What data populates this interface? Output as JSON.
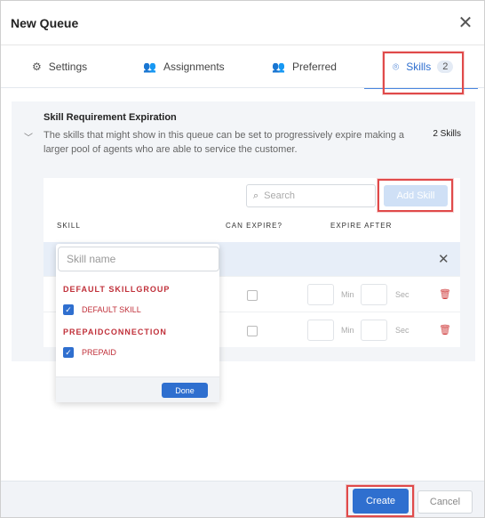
{
  "dialog": {
    "title": "New Queue",
    "close_icon": "close-icon"
  },
  "tabs": [
    {
      "label": "Settings",
      "icon": "gear-icon"
    },
    {
      "label": "Assignments",
      "icon": "users-icon"
    },
    {
      "label": "Preferred",
      "icon": "users-icon"
    },
    {
      "label": "Skills",
      "icon": "location-pin-icon",
      "badge": "2",
      "active": true
    }
  ],
  "section": {
    "title": "Skill Requirement Expiration",
    "description": "The skills that might show in this queue can be set to progressively expire making a larger pool of agents who are able to service the customer.",
    "count": "2 Skills"
  },
  "toolbar": {
    "search_placeholder": "Search",
    "add_skill": "Add Skill"
  },
  "columns": {
    "skill": "SKILL",
    "can_expire": "CAN EXPIRE?",
    "expire_after": "EXPIRE AFTER"
  },
  "row_units": {
    "min": "Min",
    "sec": "Sec"
  },
  "skill_picker": {
    "placeholder": "Skill name",
    "groups": [
      {
        "name": "DEFAULT SKILLGROUP",
        "option": "DEFAULT SKILL",
        "checked": true
      },
      {
        "name": "PREPAIDCONNECTION",
        "option": "PREPAID",
        "checked": true
      }
    ],
    "done": "Done"
  },
  "footer": {
    "create": "Create",
    "cancel": "Cancel"
  },
  "colors": {
    "accent": "#2f6fcf",
    "highlight_box": "#e04a4a",
    "skill_group_text": "#c0303a"
  }
}
